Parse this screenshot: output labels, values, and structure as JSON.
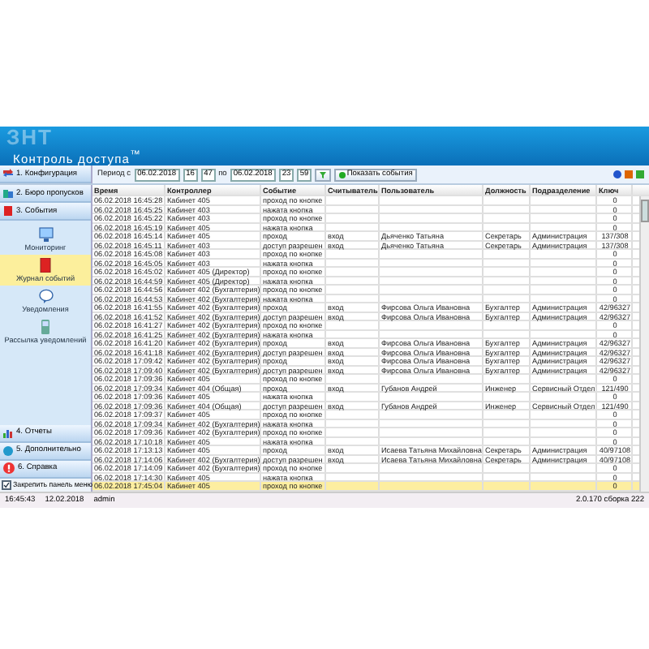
{
  "header": {
    "logo_text": "ЗНТ",
    "title": "Контроль доступа$^{™}$"
  },
  "toolbar": {
    "period_label": "Период с",
    "date_from": "06.02.2018",
    "time_from_h": "16",
    "time_from_m": "47",
    "to_label": "по",
    "date_to": "06.02.2018",
    "time_to_h": "23",
    "time_to_m": "59",
    "show_button": "Показать события"
  },
  "sidebar": {
    "sections": [
      {
        "label": "1. Конфигурация",
        "kind": "config"
      },
      {
        "label": "2. Бюро пропусков",
        "kind": "bureau"
      },
      {
        "label": "3. События",
        "kind": "events",
        "children": [
          {
            "label": "Мониторинг",
            "selected": false,
            "kind": "monitor"
          },
          {
            "label": "Журнал событий",
            "selected": true,
            "kind": "journal"
          },
          {
            "label": "Уведомления",
            "selected": false,
            "kind": "bubble"
          },
          {
            "label": "Рассылка уведомлений",
            "selected": false,
            "kind": "phone"
          }
        ]
      },
      {
        "label": "4. Отчеты",
        "kind": "reports"
      },
      {
        "label": "5. Дополнительно",
        "kind": "extra"
      },
      {
        "label": "6. Справка",
        "kind": "help"
      }
    ],
    "pin": {
      "label": "Закрепить панель меню",
      "checked": true
    }
  },
  "table": {
    "columns": [
      "Время",
      "Контроллер",
      "Событие",
      "Считыватель",
      "Пользователь",
      "Должность",
      "Подразделение",
      "Ключ"
    ],
    "rows": [
      {
        "cells": [
          "06.02.2018 16:45:28",
          "Кабинет 405",
          "проход по кнопке",
          "",
          "",
          "",
          "",
          "0"
        ],
        "selected": false
      },
      {
        "cells": [
          "06.02.2018 16:45:25",
          "Кабинет 403",
          "нажата кнопка",
          "",
          "",
          "",
          "",
          "0"
        ],
        "selected": false
      },
      {
        "cells": [
          "06.02.2018 16:45:22",
          "Кабинет 403",
          "проход по кнопке",
          "",
          "",
          "",
          "",
          "0"
        ],
        "selected": false
      },
      {
        "cells": [
          "06.02.2018 16:45:19",
          "Кабинет 405",
          "нажата кнопка",
          "",
          "",
          "",
          "",
          "0"
        ],
        "selected": false
      },
      {
        "cells": [
          "06.02.2018 16:45:14",
          "Кабинет 405",
          "проход",
          "вход",
          "Дьяченко Татьяна",
          "Секретарь",
          "Администрация",
          "137/308"
        ],
        "selected": false
      },
      {
        "cells": [
          "06.02.2018 16:45:11",
          "Кабинет 403",
          "доступ разрешен",
          "вход",
          "Дьяченко Татьяна",
          "Секретарь",
          "Администрация",
          "137/308"
        ],
        "selected": false
      },
      {
        "cells": [
          "06.02.2018 16:45:08",
          "Кабинет 403",
          "проход по кнопке",
          "",
          "",
          "",
          "",
          "0"
        ],
        "selected": false
      },
      {
        "cells": [
          "06.02.2018 16:45:05",
          "Кабинет 403",
          "нажата кнопка",
          "",
          "",
          "",
          "",
          "0"
        ],
        "selected": false
      },
      {
        "cells": [
          "06.02.2018 16:45:02",
          "Кабинет 405 (Директор)",
          "проход по кнопке",
          "",
          "",
          "",
          "",
          "0"
        ],
        "selected": false
      },
      {
        "cells": [
          "06.02.2018 16:44:59",
          "Кабинет 405 (Директор)",
          "нажата кнопка",
          "",
          "",
          "",
          "",
          "0"
        ],
        "selected": false
      },
      {
        "cells": [
          "06.02.2018 16:44:56",
          "Кабинет 402 (Бухгалтерия)",
          "проход по кнопке",
          "",
          "",
          "",
          "",
          "0"
        ],
        "selected": false
      },
      {
        "cells": [
          "06.02.2018 16:44:53",
          "Кабинет 402 (Бухгалтерия)",
          "нажата кнопка",
          "",
          "",
          "",
          "",
          "0"
        ],
        "selected": false
      },
      {
        "cells": [
          "06.02.2018 16:41:55",
          "Кабинет 402 (Бухгалтерия)",
          "проход",
          "вход",
          "Фирсова Ольга Ивановна",
          "Бухгалтер",
          "Администрация",
          "42/96327"
        ],
        "selected": false
      },
      {
        "cells": [
          "06.02.2018 16:41:52",
          "Кабинет 402 (Бухгалтерия)",
          "доступ разрешен",
          "вход",
          "Фирсова Ольга Ивановна",
          "Бухгалтер",
          "Администрация",
          "42/96327"
        ],
        "selected": false
      },
      {
        "cells": [
          "06.02.2018 16:41:27",
          "Кабинет 402 (Бухгалтерия)",
          "проход по кнопке",
          "",
          "",
          "",
          "",
          "0"
        ],
        "selected": false
      },
      {
        "cells": [
          "06.02.2018 16:41:25",
          "Кабинет 402 (Бухгалтерия)",
          "нажата кнопка",
          "",
          "",
          "",
          "",
          "0"
        ],
        "selected": false
      },
      {
        "cells": [
          "06.02.2018 16:41:20",
          "Кабинет 402 (Бухгалтерия)",
          "проход",
          "вход",
          "Фирсова Ольга Ивановна",
          "Бухгалтер",
          "Администрация",
          "42/96327"
        ],
        "selected": false
      },
      {
        "cells": [
          "06.02.2018 16:41:18",
          "Кабинет 402 (Бухгалтерия)",
          "доступ разрешен",
          "вход",
          "Фирсова Ольга Ивановна",
          "Бухгалтер",
          "Администрация",
          "42/96327"
        ],
        "selected": false
      },
      {
        "cells": [
          "06.02.2018 17:09:42",
          "Кабинет 402 (Бухгалтерия)",
          "проход",
          "вход",
          "Фирсова Ольга Ивановна",
          "Бухгалтер",
          "Администрация",
          "42/96327"
        ],
        "selected": false
      },
      {
        "cells": [
          "06.02.2018 17:09:40",
          "Кабинет 402 (Бухгалтерия)",
          "доступ разрешен",
          "вход",
          "Фирсова Ольга Ивановна",
          "Бухгалтер",
          "Администрация",
          "42/96327"
        ],
        "selected": false
      },
      {
        "cells": [
          "06.02.2018 17:09:36",
          "Кабинет 405",
          "проход по кнопке",
          "",
          "",
          "",
          "",
          "0"
        ],
        "selected": false
      },
      {
        "cells": [
          "06.02.2018 17:09:34",
          "Кабинет 404 (Общая)",
          "проход",
          "вход",
          "Губанов Андрей",
          "Инженер",
          "Сервисный Отдел",
          "121/490"
        ],
        "selected": false
      },
      {
        "cells": [
          "06.02.2018 17:09:36",
          "Кабинет 405",
          "нажата кнопка",
          "",
          "",
          "",
          "",
          "0"
        ],
        "selected": false
      },
      {
        "cells": [
          "06.02.2018 17:09:36",
          "Кабинет 404 (Общая)",
          "доступ разрешен",
          "вход",
          "Губанов Андрей",
          "Инженер",
          "Сервисный Отдел",
          "121/490"
        ],
        "selected": false
      },
      {
        "cells": [
          "06.02.2018 17:09:37",
          "Кабинет 405",
          "проход по кнопке",
          "",
          "",
          "",
          "",
          "0"
        ],
        "selected": false
      },
      {
        "cells": [
          "06.02.2018 17:09:34",
          "Кабинет 402 (Бухгалтерия)",
          "нажата кнопка",
          "",
          "",
          "",
          "",
          "0"
        ],
        "selected": false
      },
      {
        "cells": [
          "06.02.2018 17:09:36",
          "Кабинет 402 (Бухгалтерия)",
          "проход по кнопке",
          "",
          "",
          "",
          "",
          "0"
        ],
        "selected": false
      },
      {
        "cells": [
          "06.02.2018 17:10:18",
          "Кабинет 405",
          "нажата кнопка",
          "",
          "",
          "",
          "",
          "0"
        ],
        "selected": false
      },
      {
        "cells": [
          "06.02.2018 17:13:13",
          "Кабинет 405",
          "проход",
          "вход",
          "Исаева Татьяна Михайловна",
          "Секретарь",
          "Администрация",
          "40/97108"
        ],
        "selected": false
      },
      {
        "cells": [
          "06.02.2018 17:14:06",
          "Кабинет 402 (Бухгалтерия)",
          "доступ разрешен",
          "вход",
          "Исаева Татьяна Михайловна",
          "Секретарь",
          "Администрация",
          "40/97108"
        ],
        "selected": false
      },
      {
        "cells": [
          "06.02.2018 17:14:09",
          "Кабинет 402 (Бухгалтерия)",
          "проход по кнопке",
          "",
          "",
          "",
          "",
          "0"
        ],
        "selected": false
      },
      {
        "cells": [
          "06.02.2018 17:14:30",
          "Кабинет 405",
          "нажата кнопка",
          "",
          "",
          "",
          "",
          "0"
        ],
        "selected": false
      },
      {
        "cells": [
          "06.02.2018 17:45:04",
          "Кабинет 405",
          "проход по кнопке",
          "",
          "",
          "",
          "",
          "0"
        ],
        "selected": true
      }
    ]
  },
  "status_bar": {
    "time": "16:45:43",
    "date": "12.02.2018",
    "user": "admin",
    "version": "2.0.170 сборка 222"
  }
}
